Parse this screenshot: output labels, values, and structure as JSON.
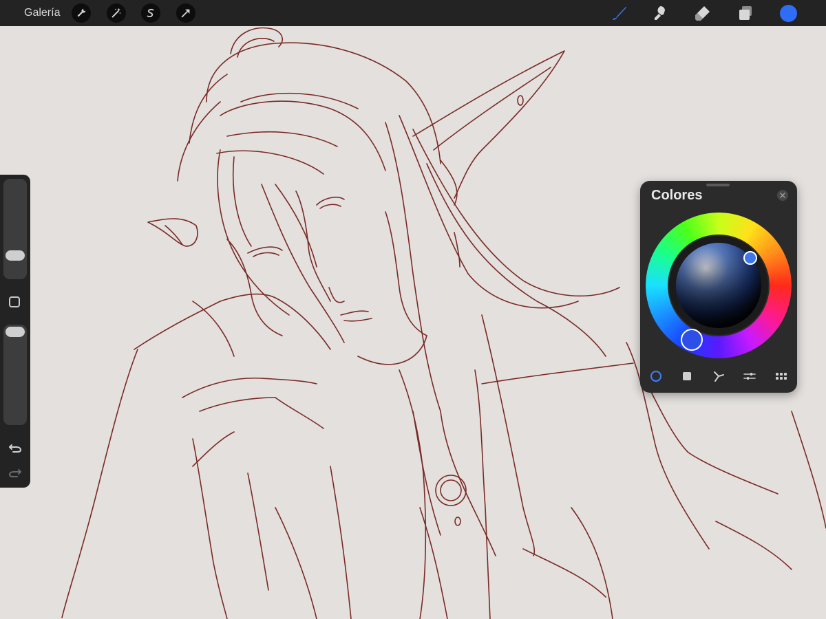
{
  "toolbar": {
    "gallery_label": "Galería",
    "left_tools": [
      "wrench-icon",
      "magic-wand-icon",
      "selection-icon",
      "transform-arrow-icon"
    ],
    "right_tools": [
      "brush-icon",
      "smudge-icon",
      "eraser-icon",
      "layers-icon"
    ],
    "active_tool": "brush",
    "active_color": "#2f6df6"
  },
  "sidebar": {
    "brush_size_level": 0.22,
    "opacity_level": 0.92
  },
  "color_panel": {
    "title": "Colores",
    "tabs": [
      "disc",
      "classic",
      "harmony",
      "values",
      "palettes"
    ],
    "active_tab": "disc"
  }
}
